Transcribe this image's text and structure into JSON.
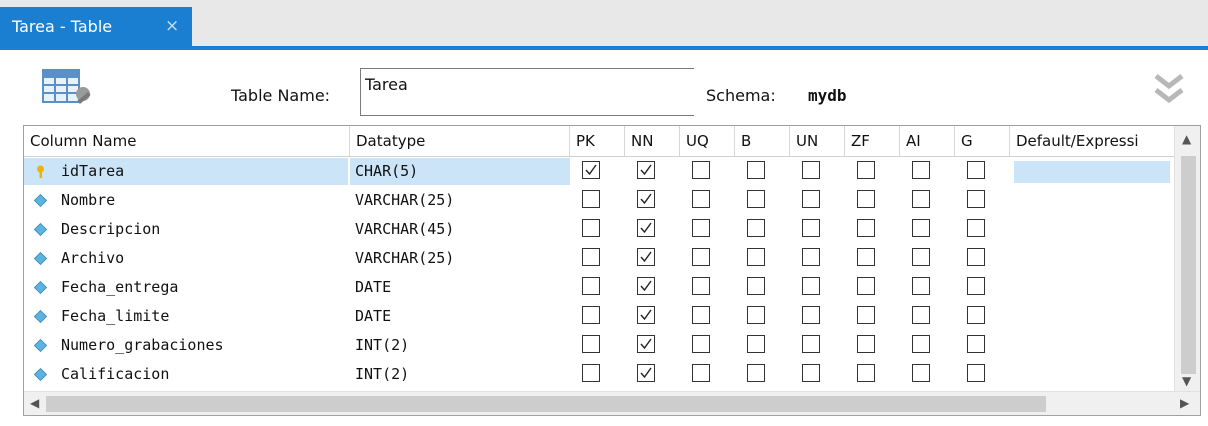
{
  "tab": {
    "label": "Tarea - Table",
    "close": "×"
  },
  "form": {
    "table_name_label": "Table Name:",
    "table_name_value": "Tarea",
    "schema_label": "Schema:",
    "schema_value": "mydb"
  },
  "columns_header": [
    "Column Name",
    "Datatype",
    "PK",
    "NN",
    "UQ",
    "B",
    "UN",
    "ZF",
    "AI",
    "G",
    "Default/Expressi"
  ],
  "rows": [
    {
      "name": "idTarea",
      "type": "CHAR(5)",
      "pk": true,
      "nn": true,
      "uq": false,
      "b": false,
      "un": false,
      "zf": false,
      "ai": false,
      "g": false,
      "icon": "key-icon",
      "selected": true
    },
    {
      "name": "Nombre",
      "type": "VARCHAR(25)",
      "pk": false,
      "nn": true,
      "uq": false,
      "b": false,
      "un": false,
      "zf": false,
      "ai": false,
      "g": false,
      "icon": "diamond-icon"
    },
    {
      "name": "Descripcion",
      "type": "VARCHAR(45)",
      "pk": false,
      "nn": true,
      "uq": false,
      "b": false,
      "un": false,
      "zf": false,
      "ai": false,
      "g": false,
      "icon": "diamond-icon"
    },
    {
      "name": "Archivo",
      "type": "VARCHAR(25)",
      "pk": false,
      "nn": true,
      "uq": false,
      "b": false,
      "un": false,
      "zf": false,
      "ai": false,
      "g": false,
      "icon": "diamond-icon"
    },
    {
      "name": "Fecha_entrega",
      "type": "DATE",
      "pk": false,
      "nn": true,
      "uq": false,
      "b": false,
      "un": false,
      "zf": false,
      "ai": false,
      "g": false,
      "icon": "diamond-icon"
    },
    {
      "name": "Fecha_limite",
      "type": "DATE",
      "pk": false,
      "nn": true,
      "uq": false,
      "b": false,
      "un": false,
      "zf": false,
      "ai": false,
      "g": false,
      "icon": "diamond-icon"
    },
    {
      "name": "Numero_grabaciones",
      "type": "INT(2)",
      "pk": false,
      "nn": true,
      "uq": false,
      "b": false,
      "un": false,
      "zf": false,
      "ai": false,
      "g": false,
      "icon": "diamond-icon"
    },
    {
      "name": "Calificacion",
      "type": "INT(2)",
      "pk": false,
      "nn": true,
      "uq": false,
      "b": false,
      "un": false,
      "zf": false,
      "ai": false,
      "g": false,
      "icon": "diamond-icon"
    }
  ],
  "colors": {
    "accent": "#1a7fd0",
    "selection": "#cce4f7",
    "key": "#f0b400",
    "diamond": "#5bb4e0"
  }
}
